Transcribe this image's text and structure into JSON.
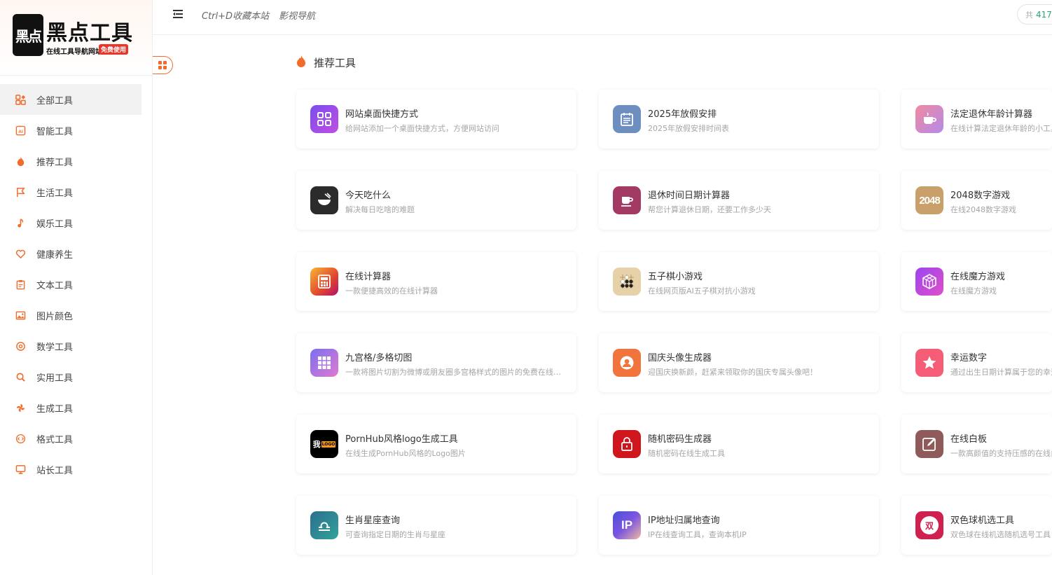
{
  "logo": {
    "mark": "黑点",
    "title": "黑点工具",
    "subtitle": "在线工具导航网站",
    "badge": "免费使用"
  },
  "sidebar": {
    "items": [
      {
        "label": "全部工具",
        "icon": "apps-icon",
        "active": true
      },
      {
        "label": "智能工具",
        "icon": "ai-icon"
      },
      {
        "label": "推荐工具",
        "icon": "fire-icon"
      },
      {
        "label": "生活工具",
        "icon": "flag-icon"
      },
      {
        "label": "娱乐工具",
        "icon": "music-note-icon"
      },
      {
        "label": "健康养生",
        "icon": "heart-icon"
      },
      {
        "label": "文本工具",
        "icon": "clipboard-icon"
      },
      {
        "label": "图片颜色",
        "icon": "image-icon"
      },
      {
        "label": "数学工具",
        "icon": "at-icon"
      },
      {
        "label": "实用工具",
        "icon": "search-icon"
      },
      {
        "label": "生成工具",
        "icon": "pinwheel-icon"
      },
      {
        "label": "格式工具",
        "icon": "code-icon"
      },
      {
        "label": "站长工具",
        "icon": "monitor-icon"
      }
    ]
  },
  "topbar": {
    "links": [
      "Ctrl+D收藏本站",
      "影视导航"
    ],
    "counter_prefix": "共",
    "counter_value": "417"
  },
  "section": {
    "title": "推荐工具"
  },
  "cards": [
    {
      "title": "网站桌面快捷方式",
      "desc": "给网站添加一个桌面快捷方式，方便网站访问",
      "icon": "shortcut-icon",
      "color": "#9b45f0"
    },
    {
      "title": "2025年放假安排",
      "desc": "2025年放假安排时间表",
      "icon": "calendar-icon",
      "color": "#6d8fc0"
    },
    {
      "title": "法定退休年龄计算器",
      "desc": "在线计算法定退休年龄的小工具",
      "icon": "coffee-cup-icon",
      "color": "#e87aa0"
    },
    {
      "title": "今天吃什么",
      "desc": "解决每日吃啥的难题",
      "icon": "bowl-icon",
      "color": "#2b2b2b"
    },
    {
      "title": "退休时间日期计算器",
      "desc": "帮您计算退休日期，还要工作多少天",
      "icon": "mug-icon",
      "color": "#a23a63"
    },
    {
      "title": "2048数字游戏",
      "desc": "在线2048数字游戏",
      "icon": "2048-icon",
      "color": "#c9a06a",
      "icon_text": "2048"
    },
    {
      "title": "在线计算器",
      "desc": "一款便捷高效的在线计算器",
      "icon": "calculator-icon",
      "color": "#e0452f"
    },
    {
      "title": "五子棋小游戏",
      "desc": "在线网页版AI五子棋对抗小游戏",
      "icon": "gomoku-icon",
      "color": "#e6d1a8"
    },
    {
      "title": "在线魔方游戏",
      "desc": "在线魔方游戏",
      "icon": "rubik-cube-icon",
      "color": "#c04ee0"
    },
    {
      "title": "九宫格/多格切图",
      "desc": "一款将图片切割为微博或朋友圈多宫格样式的图片的免费在线工具",
      "icon": "grid-nine-icon",
      "color": "#a56ee8"
    },
    {
      "title": "国庆头像生成器",
      "desc": "迎国庆换新颜，赶紧来领取你的国庆专属头像吧！",
      "icon": "avatar-icon",
      "color": "#f2743d"
    },
    {
      "title": "幸运数字",
      "desc": "通过出生日期计算属于您的幸运数字",
      "icon": "star-icon",
      "color": "#f45d75"
    },
    {
      "title": "PornHub风格logo生成工具",
      "desc": "在线生成PornHub风格的Logo图片",
      "icon": "logo-generator-icon",
      "color": "#000000",
      "icon_text": "我",
      "icon_badge": "LOGO"
    },
    {
      "title": "随机密码生成器",
      "desc": "随机密码在线生成工具",
      "icon": "lock-icon",
      "color": "#d0161d"
    },
    {
      "title": "在线白板",
      "desc": "一款高颜值的支持压感的在线白板",
      "icon": "edit-board-icon",
      "color": "#8e5a5a"
    },
    {
      "title": "生肖星座查询",
      "desc": "可查询指定日期的生肖与星座",
      "icon": "libra-icon",
      "color": "#2f8f96"
    },
    {
      "title": "IP地址归属地查询",
      "desc": "IP在线查询工具，查询本机IP",
      "icon": "ip-icon",
      "color": "#6a4fd8",
      "icon_text": "IP"
    },
    {
      "title": "双色球机选工具",
      "desc": "双色球在线机选随机选号工具",
      "icon": "lottery-icon",
      "color": "#d02050",
      "icon_text": "双"
    }
  ]
}
